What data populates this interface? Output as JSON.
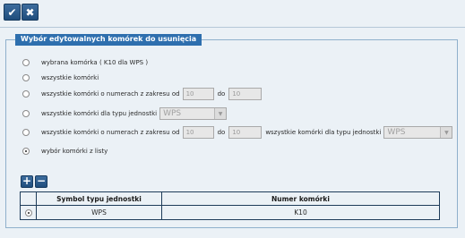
{
  "toolbar": {
    "ok_icon": "checkmark-icon",
    "cancel_icon": "cross-icon"
  },
  "group": {
    "title": "Wybór edytowalnych komórek do usunięcia"
  },
  "options": [
    {
      "label": "wybrana komórka ( K10 dla WPS )",
      "checked": false
    },
    {
      "label": "wszystkie komórki",
      "checked": false
    },
    {
      "label": "wszystkie komórki o numerach z zakresu od",
      "from": "10",
      "to_label": "do",
      "to": "10",
      "checked": false
    },
    {
      "label": "wszystkie komórki dla typu jednostki",
      "type_value": "WPS",
      "checked": false
    },
    {
      "label": "wszystkie komórki o numerach z zakresu od",
      "from": "10",
      "to_label": "do",
      "to": "10",
      "type_label": "wszystkie komórki dla typu jednostki",
      "type_value": "WPS",
      "checked": false
    },
    {
      "label": "wybór komórki z listy",
      "checked": true
    }
  ],
  "grid": {
    "columns": [
      "Symbol typu jednostki",
      "Numer komórki"
    ],
    "rows": [
      {
        "symbol": "WPS",
        "number": "K10",
        "selected": true
      }
    ]
  },
  "colors": {
    "accent": "#2e6fae",
    "background": "#ebf1f6",
    "button": "#1f4d7c"
  }
}
